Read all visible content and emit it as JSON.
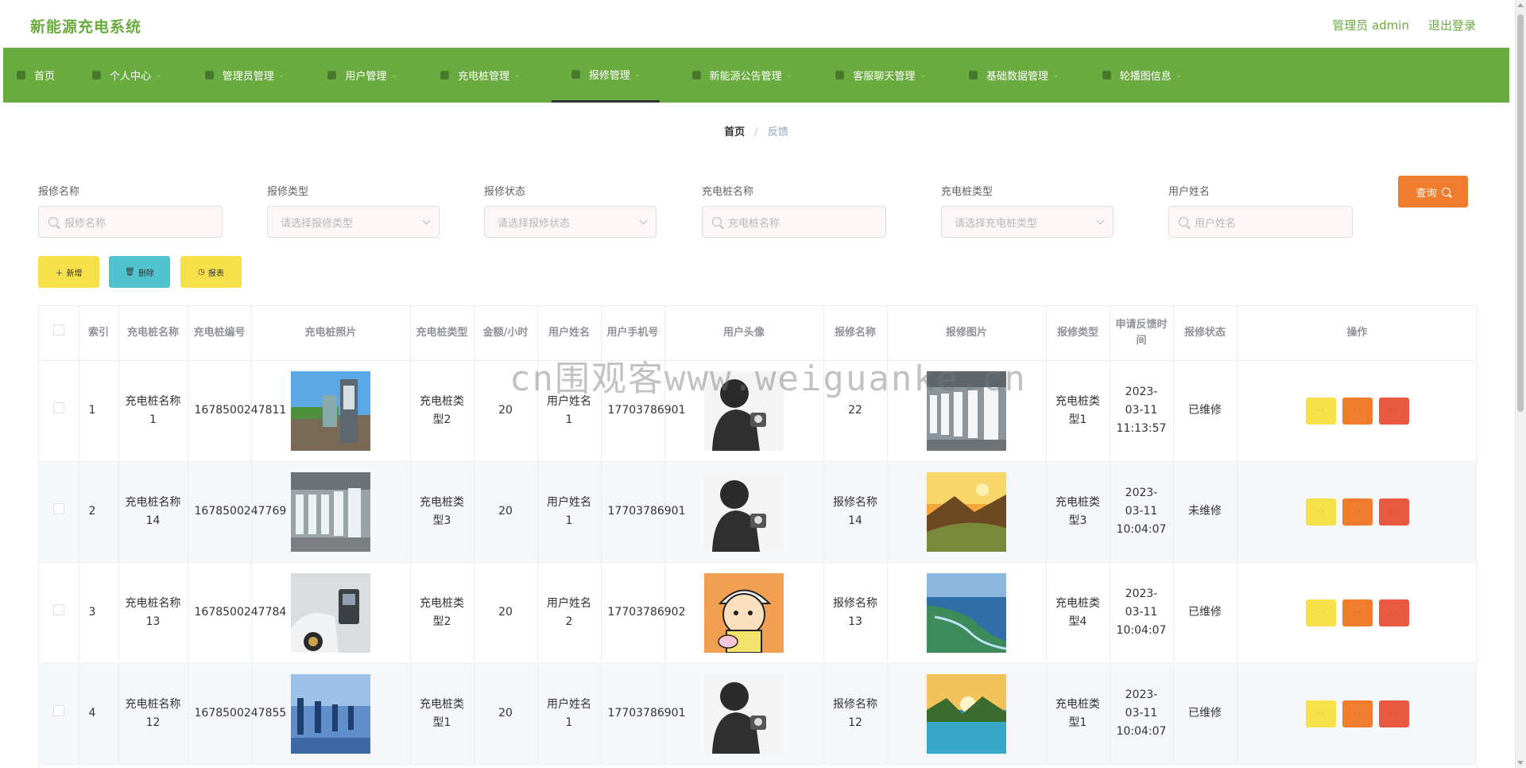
{
  "app": {
    "title": "新能源充电系统",
    "admin_label": "管理员 admin",
    "logout_label": "退出登录"
  },
  "nav": {
    "items": [
      {
        "label": "首页",
        "icon": "home-icon",
        "has_caret": false,
        "active": false
      },
      {
        "label": "个人中心",
        "icon": "user-icon",
        "has_caret": true,
        "active": false
      },
      {
        "label": "管理员管理",
        "icon": "admin-icon",
        "has_caret": true,
        "active": false
      },
      {
        "label": "用户管理",
        "icon": "users-icon",
        "has_caret": true,
        "active": false
      },
      {
        "label": "充电桩管理",
        "icon": "charger-icon",
        "has_caret": true,
        "active": false
      },
      {
        "label": "报修管理",
        "icon": "flag-icon",
        "has_caret": true,
        "active": true
      },
      {
        "label": "新能源公告管理",
        "icon": "notice-icon",
        "has_caret": true,
        "active": false
      },
      {
        "label": "客服聊天管理",
        "icon": "chat-icon",
        "has_caret": true,
        "active": false
      },
      {
        "label": "基础数据管理",
        "icon": "data-icon",
        "has_caret": true,
        "active": false
      },
      {
        "label": "轮播图信息",
        "icon": "image-icon",
        "has_caret": true,
        "active": false
      }
    ]
  },
  "breadcrumb": {
    "home": "首页",
    "separator": "/",
    "current": "反馈"
  },
  "search": {
    "repair_name": {
      "label": "报修名称",
      "placeholder": "报修名称"
    },
    "repair_type": {
      "label": "报修类型",
      "placeholder": "请选择报修类型"
    },
    "repair_status": {
      "label": "报修状态",
      "placeholder": "请选择报修状态"
    },
    "charger_name": {
      "label": "充电桩名称",
      "placeholder": "充电桩名称"
    },
    "charger_type": {
      "label": "充电桩类型",
      "placeholder": "请选择充电桩类型"
    },
    "user_name": {
      "label": "用户姓名",
      "placeholder": "用户姓名"
    },
    "query_label": "查询"
  },
  "actions": {
    "add_label": "新增",
    "delete_label": "删除",
    "report_label": "报表"
  },
  "table": {
    "headers": [
      "",
      "索引",
      "充电桩名称",
      "充电桩编号",
      "充电桩照片",
      "充电桩类型",
      "金额/小时",
      "用户姓名",
      "用户手机号",
      "用户头像",
      "报修名称",
      "报修图片",
      "报修类型",
      "申请反馈时间",
      "报修状态",
      "操作"
    ],
    "rows": [
      {
        "index": "1",
        "charger_name": "充电桩名称1",
        "charger_no": "1678500247811",
        "charger_photo": "charger-photo-street",
        "charger_type": "充电桩类型2",
        "price": "20",
        "user_name": "用户姓名1",
        "phone": "17703786901",
        "avatar": "avatar-silhouette",
        "repair_name": "22",
        "repair_image": "repair-image-stations",
        "repair_type": "充电桩类型1",
        "apply_time": "2023-03-11 11:13:57",
        "status": "已维修"
      },
      {
        "index": "2",
        "charger_name": "充电桩名称14",
        "charger_no": "1678500247769",
        "charger_photo": "charger-photo-row",
        "charger_type": "充电桩类型3",
        "price": "20",
        "user_name": "用户姓名1",
        "phone": "17703786901",
        "avatar": "avatar-silhouette",
        "repair_name": "报修名称14",
        "repair_image": "repair-image-mountain",
        "repair_type": "充电桩类型3",
        "apply_time": "2023-03-11 10:04:07",
        "status": "未维修"
      },
      {
        "index": "3",
        "charger_name": "充电桩名称13",
        "charger_no": "1678500247784",
        "charger_photo": "charger-photo-car",
        "charger_type": "充电桩类型2",
        "price": "20",
        "user_name": "用户姓名2",
        "phone": "17703786902",
        "avatar": "avatar-cartoon",
        "repair_name": "报修名称13",
        "repair_image": "repair-image-river",
        "repair_type": "充电桩类型4",
        "apply_time": "2023-03-11 10:04:07",
        "status": "已维修"
      },
      {
        "index": "4",
        "charger_name": "充电桩名称12",
        "charger_no": "1678500247855",
        "charger_photo": "charger-photo-blue",
        "charger_type": "充电桩类型1",
        "price": "20",
        "user_name": "用户姓名1",
        "phone": "17703786901",
        "avatar": "avatar-silhouette",
        "repair_name": "报修名称12",
        "repair_image": "repair-image-lake",
        "repair_type": "充电桩类型1",
        "apply_time": "2023-03-11 10:04:07",
        "status": "已维修"
      }
    ]
  },
  "watermark": "cn围观客www.weiguanke.cn",
  "colors": {
    "brand_green": "#6aab3f",
    "query_orange": "#f07d2e",
    "button_yellow": "#f7e14a",
    "button_cyan": "#4fc3d0",
    "button_red": "#e8593f"
  }
}
